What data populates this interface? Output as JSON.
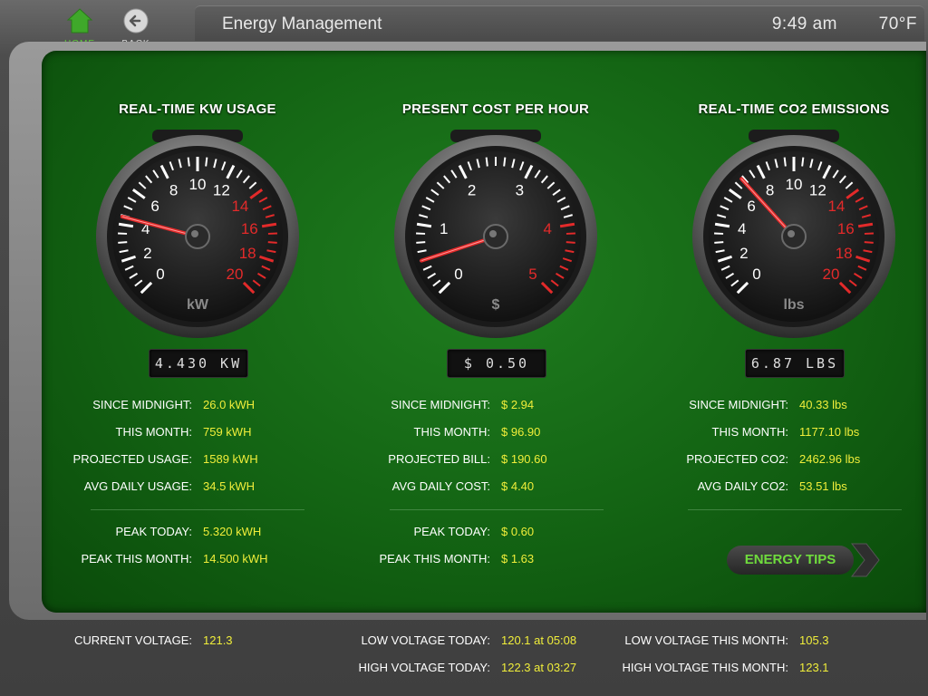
{
  "nav": {
    "home_label": "HOME",
    "back_label": "BACK"
  },
  "header": {
    "title": "Energy Management",
    "time": "9:49 am",
    "temperature": "70°F"
  },
  "colors": {
    "accent_green": "#5fd13a",
    "value_yellow": "#f0ee3a",
    "gauge_red": "#e32a2a"
  },
  "kw": {
    "title": "REAL-TIME KW USAGE",
    "unit": "kW",
    "lcd": "4.430 KW",
    "gauge": {
      "value": 4.43,
      "min": 0,
      "max": 20,
      "ticks": [
        "0",
        "2",
        "4",
        "6",
        "8",
        "10",
        "12",
        "14",
        "16",
        "18",
        "20"
      ],
      "red_from": 14
    },
    "stats": [
      {
        "label": "SINCE MIDNIGHT:",
        "value": "26.0 kWH"
      },
      {
        "label": "THIS MONTH:",
        "value": "759 kWH"
      },
      {
        "label": "PROJECTED USAGE:",
        "value": "1589 kWH"
      },
      {
        "label": "AVG DAILY USAGE:",
        "value": "34.5 kWH"
      }
    ],
    "peaks": [
      {
        "label": "PEAK TODAY:",
        "value": "5.320 kWH"
      },
      {
        "label": "PEAK THIS MONTH:",
        "value": "14.500 kWH"
      }
    ]
  },
  "cost": {
    "title": "PRESENT COST PER HOUR",
    "unit": "$",
    "lcd": "$ 0.50",
    "gauge": {
      "value": 0.5,
      "min": 0,
      "max": 5,
      "ticks": [
        "0",
        "1",
        "2",
        "3",
        "4",
        "5"
      ],
      "red_from": 4
    },
    "stats": [
      {
        "label": "SINCE MIDNIGHT:",
        "value": "$ 2.94"
      },
      {
        "label": "THIS MONTH:",
        "value": "$ 96.90"
      },
      {
        "label": "PROJECTED BILL:",
        "value": "$ 190.60"
      },
      {
        "label": "AVG DAILY COST:",
        "value": "$ 4.40"
      }
    ],
    "peaks": [
      {
        "label": "PEAK TODAY:",
        "value": "$ 0.60"
      },
      {
        "label": "PEAK THIS MONTH:",
        "value": "$ 1.63"
      }
    ]
  },
  "co2": {
    "title": "REAL-TIME CO2 EMISSIONS",
    "unit": "lbs",
    "lcd": "6.87 LBS",
    "gauge": {
      "value": 6.87,
      "min": 0,
      "max": 20,
      "ticks": [
        "0",
        "2",
        "4",
        "6",
        "8",
        "10",
        "12",
        "14",
        "16",
        "18",
        "20"
      ],
      "red_from": 14
    },
    "stats": [
      {
        "label": "SINCE MIDNIGHT:",
        "value": "40.33 lbs"
      },
      {
        "label": "THIS MONTH:",
        "value": "1177.10 lbs"
      },
      {
        "label": "PROJECTED CO2:",
        "value": "2462.96 lbs"
      },
      {
        "label": "AVG DAILY CO2:",
        "value": "53.51 lbs"
      }
    ]
  },
  "tips_button": {
    "label": "ENERGY TIPS"
  },
  "voltage": {
    "current_label": "CURRENT VOLTAGE:",
    "current_value": "121.3",
    "low_today_label": "LOW VOLTAGE TODAY:",
    "low_today_value": "120.1 at 05:08",
    "high_today_label": "HIGH VOLTAGE TODAY:",
    "high_today_value": "122.3 at 03:27",
    "low_month_label": "LOW VOLTAGE THIS MONTH:",
    "low_month_value": "105.3",
    "high_month_label": "HIGH VOLTAGE THIS MONTH:",
    "high_month_value": "123.1"
  }
}
